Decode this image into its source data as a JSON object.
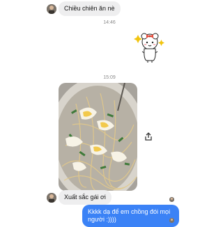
{
  "chat": {
    "messages": [
      {
        "from": "them",
        "text": "Chiều chiên ăn nè"
      },
      {
        "timestamp": "14:46"
      },
      {
        "from": "them",
        "sticker": "white-sheep-bunny-sticker"
      },
      {
        "timestamp": "15:09"
      },
      {
        "from": "them",
        "photo": "fried-noodles-with-egg-photo"
      },
      {
        "from": "them",
        "text": "Xuất sắc gái ơi"
      },
      {
        "from": "me",
        "text": "Kkkk dạ để em chồng đói mọi người :))))"
      }
    ],
    "msg1": "Chiều chiên ăn nè",
    "time1": "14:46",
    "time2": "15:09",
    "msg2": "Xuất sắc gái ơi",
    "reply": "Kkkk dạ để em chồng đói mọi người :))))"
  },
  "colors": {
    "incoming_bubble": "#eeeeef",
    "outgoing_bubble": "#3b82f6",
    "timestamp": "#8a8a8a"
  },
  "icons": [
    "avatar",
    "sticker",
    "share-icon",
    "seen-avatar"
  ]
}
